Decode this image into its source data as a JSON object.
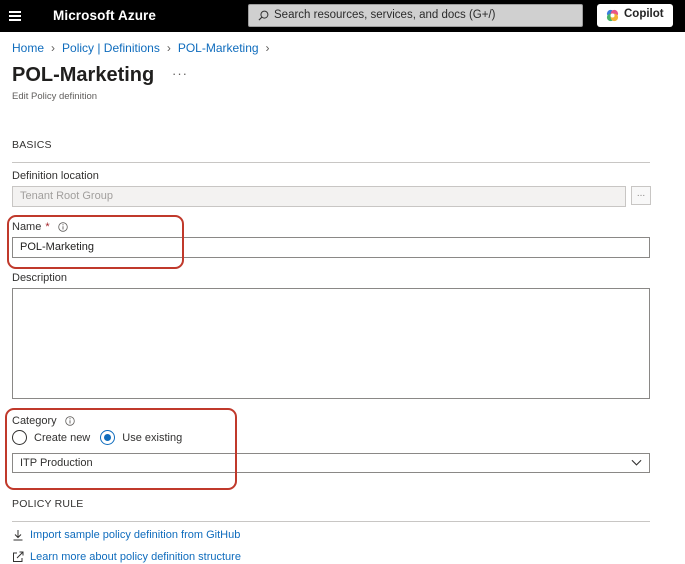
{
  "topbar": {
    "brand": "Microsoft Azure",
    "search_placeholder": "Search resources, services, and docs (G+/)",
    "copilot_label": "Copilot"
  },
  "breadcrumb": {
    "items": [
      "Home",
      "Policy | Definitions",
      "POL-Marketing"
    ]
  },
  "page": {
    "title": "POL-Marketing",
    "more": "···",
    "subtitle": "Edit Policy definition"
  },
  "basics": {
    "section_title": "BASICS",
    "definition_location_label": "Definition location",
    "definition_location_value": "Tenant Root Group",
    "browse_label": "...",
    "name_label": "Name",
    "name_required": "*",
    "name_value": "POL-Marketing",
    "description_label": "Description",
    "description_value": "",
    "category_label": "Category",
    "category_options": [
      "Create new",
      "Use existing"
    ],
    "category_selected": "Use existing",
    "category_value": "ITP Production"
  },
  "policy_rule": {
    "section_title": "POLICY RULE",
    "import_link": "Import sample policy definition from GitHub",
    "learn_link": "Learn more about policy definition structure"
  },
  "colors": {
    "topbar_bg": "#000000",
    "link": "#0f6cbd",
    "highlight": "#c0392b",
    "required": "#a4262c"
  },
  "icons": [
    "hamburger-icon",
    "search-icon",
    "copilot-icon",
    "chevron-right-icon",
    "info-icon",
    "chevron-down-icon",
    "download-icon",
    "external-link-icon"
  ]
}
